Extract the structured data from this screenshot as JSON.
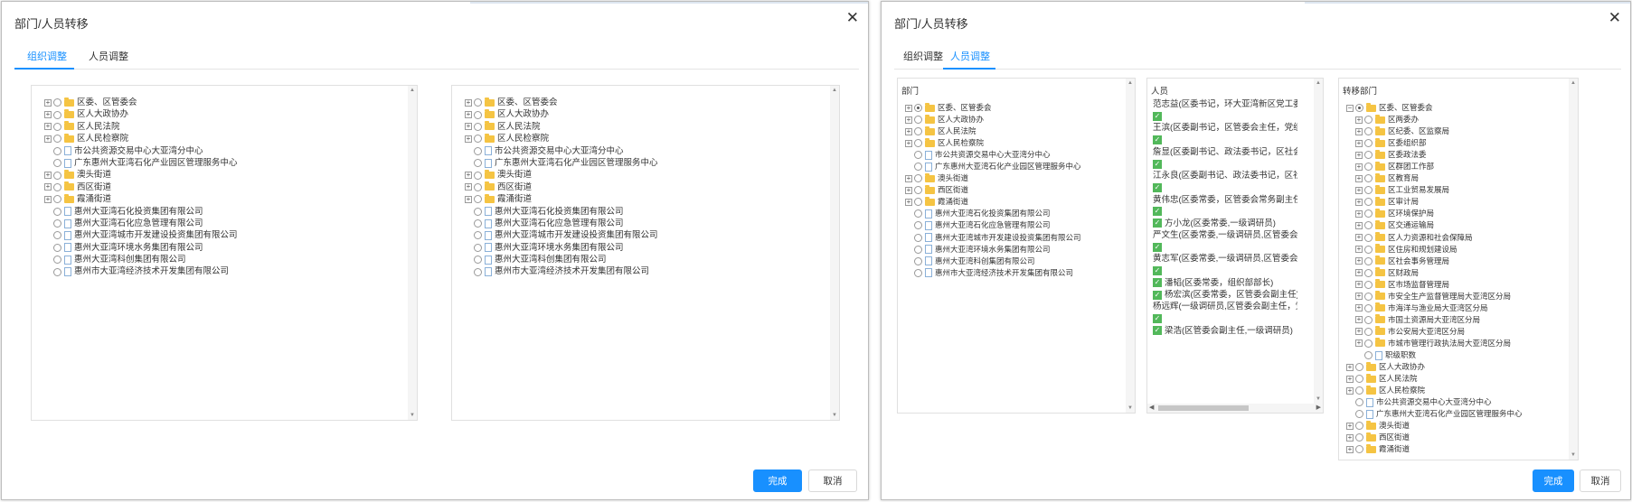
{
  "dialog1": {
    "title": "部门/人员转移",
    "tabs": {
      "org": "组织调整",
      "people": "人员调整"
    },
    "left_tree": [
      {
        "exp": "+",
        "icon": "folder",
        "label": "区委、区管委会"
      },
      {
        "exp": "+",
        "icon": "folder",
        "label": "区人大政协办"
      },
      {
        "exp": "+",
        "icon": "folder",
        "label": "区人民法院"
      },
      {
        "exp": "+",
        "icon": "folder",
        "label": "区人民检察院"
      },
      {
        "exp": "",
        "icon": "doc",
        "label": "市公共资源交易中心大亚湾分中心"
      },
      {
        "exp": "",
        "icon": "doc",
        "label": "广东惠州大亚湾石化产业园区管理服务中心"
      },
      {
        "exp": "+",
        "icon": "folder",
        "label": "澳头街道"
      },
      {
        "exp": "+",
        "icon": "folder",
        "label": "西区街道"
      },
      {
        "exp": "+",
        "icon": "folder",
        "label": "霞涌街道"
      },
      {
        "exp": "",
        "icon": "doc",
        "label": "惠州大亚湾石化投资集团有限公司"
      },
      {
        "exp": "",
        "icon": "doc",
        "label": "惠州大亚湾石化应急管理有限公司"
      },
      {
        "exp": "",
        "icon": "doc",
        "label": "惠州大亚湾城市开发建设投资集团有限公司"
      },
      {
        "exp": "",
        "icon": "doc",
        "label": "惠州大亚湾环境水务集团有限公司"
      },
      {
        "exp": "",
        "icon": "doc",
        "label": "惠州大亚湾科创集团有限公司"
      },
      {
        "exp": "",
        "icon": "doc",
        "label": "惠州市大亚湾经济技术开发集团有限公司"
      }
    ],
    "right_tree": [
      {
        "exp": "+",
        "icon": "folder",
        "label": "区委、区管委会"
      },
      {
        "exp": "+",
        "icon": "folder",
        "label": "区人大政协办"
      },
      {
        "exp": "+",
        "icon": "folder",
        "label": "区人民法院"
      },
      {
        "exp": "+",
        "icon": "folder",
        "label": "区人民检察院"
      },
      {
        "exp": "",
        "icon": "doc",
        "label": "市公共资源交易中心大亚湾分中心"
      },
      {
        "exp": "",
        "icon": "doc",
        "label": "广东惠州大亚湾石化产业园区管理服务中心"
      },
      {
        "exp": "+",
        "icon": "folder",
        "label": "澳头街道"
      },
      {
        "exp": "+",
        "icon": "folder",
        "label": "西区街道"
      },
      {
        "exp": "+",
        "icon": "folder",
        "label": "霞涌街道"
      },
      {
        "exp": "",
        "icon": "doc",
        "label": "惠州大亚湾石化投资集团有限公司"
      },
      {
        "exp": "",
        "icon": "doc",
        "label": "惠州大亚湾石化应急管理有限公司"
      },
      {
        "exp": "",
        "icon": "doc",
        "label": "惠州大亚湾城市开发建设投资集团有限公司"
      },
      {
        "exp": "",
        "icon": "doc",
        "label": "惠州大亚湾环境水务集团有限公司"
      },
      {
        "exp": "",
        "icon": "doc",
        "label": "惠州大亚湾科创集团有限公司"
      },
      {
        "exp": "",
        "icon": "doc",
        "label": "惠州市大亚湾经济技术开发集团有限公司"
      }
    ],
    "confirm": "完成",
    "cancel": "取消"
  },
  "dialog2": {
    "title": "部门/人员转移",
    "tabs": {
      "org": "组织调整",
      "people": "人员调整"
    },
    "dept_title": "部门",
    "dept_tree": [
      {
        "exp": "+",
        "icon": "folder",
        "label": "区委、区管委会",
        "sel": true
      },
      {
        "exp": "+",
        "icon": "folder",
        "label": "区人大政协办"
      },
      {
        "exp": "+",
        "icon": "folder",
        "label": "区人民法院"
      },
      {
        "exp": "+",
        "icon": "folder",
        "label": "区人民检察院"
      },
      {
        "exp": "",
        "icon": "doc",
        "label": "市公共资源交易中心大亚湾分中心"
      },
      {
        "exp": "",
        "icon": "doc",
        "label": "广东惠州大亚湾石化产业园区管理服务中心"
      },
      {
        "exp": "+",
        "icon": "folder",
        "label": "澳头街道"
      },
      {
        "exp": "+",
        "icon": "folder",
        "label": "西区街道"
      },
      {
        "exp": "+",
        "icon": "folder",
        "label": "霞涌街道"
      },
      {
        "exp": "",
        "icon": "doc",
        "label": "惠州大亚湾石化投资集团有限公司"
      },
      {
        "exp": "",
        "icon": "doc",
        "label": "惠州大亚湾石化应急管理有限公司"
      },
      {
        "exp": "",
        "icon": "doc",
        "label": "惠州大亚湾城市开发建设投资集团有限公司"
      },
      {
        "exp": "",
        "icon": "doc",
        "label": "惠州大亚湾环境水务集团有限公司"
      },
      {
        "exp": "",
        "icon": "doc",
        "label": "惠州大亚湾科创集团有限公司"
      },
      {
        "exp": "",
        "icon": "doc",
        "label": "惠州市大亚湾经济技术开发集团有限公司"
      }
    ],
    "people_title": "人员",
    "people": [
      {
        "label": "范志益(区委书记，环大亚湾新区党工委委员，管委会主任)",
        "check": "next"
      },
      {
        "label": "王滨(区委副书记，区管委会主任，党组书记)",
        "check": "next"
      },
      {
        "label": "詹显(区委副书记、政法委书记，区社会工作委员会主任)",
        "check": "next"
      },
      {
        "label": "江永良(区委副书记、政法委书记，区社会工作部部长)",
        "check": "next"
      },
      {
        "label": "黄伟忠(区委常委，区管委会常务副主任，区管委会党组副书记)",
        "check": "next"
      },
      {
        "label": "方小龙(区委常委,一级调研员)",
        "check": "inline"
      },
      {
        "label": "严文生(区委常委,一级调研员,区管委会党组成员)",
        "check": "next"
      },
      {
        "label": "黄志军(区委常委,一级调研员,区管委会党组成员)",
        "check": "next"
      },
      {
        "label": "潘韬(区委常委，组织部部长)",
        "check": "inline"
      },
      {
        "label": "杨宏滨(区委常委，区管委会副主任)",
        "check": "inline"
      },
      {
        "label": "杨远辉(一级调研员,区管委会副主任，党组成员)",
        "check": "next"
      },
      {
        "label": "梁浩(区管委会副主任,一级调研员)",
        "check": "inline"
      }
    ],
    "target_title": "转移部门",
    "target_tree": [
      {
        "lvl": 0,
        "exp": "−",
        "icon": "folder",
        "label": "区委、区管委会",
        "sel": true
      },
      {
        "lvl": 1,
        "exp": "+",
        "icon": "folder",
        "label": "区两委办"
      },
      {
        "lvl": 1,
        "exp": "+",
        "icon": "folder",
        "label": "区纪委、区监察局"
      },
      {
        "lvl": 1,
        "exp": "+",
        "icon": "folder",
        "label": "区委组织部"
      },
      {
        "lvl": 1,
        "exp": "+",
        "icon": "folder",
        "label": "区委政法委"
      },
      {
        "lvl": 1,
        "exp": "+",
        "icon": "folder",
        "label": "区群团工作部"
      },
      {
        "lvl": 1,
        "exp": "+",
        "icon": "folder",
        "label": "区教育局"
      },
      {
        "lvl": 1,
        "exp": "+",
        "icon": "folder",
        "label": "区工业贸易发展局"
      },
      {
        "lvl": 1,
        "exp": "+",
        "icon": "folder",
        "label": "区审计局"
      },
      {
        "lvl": 1,
        "exp": "+",
        "icon": "folder",
        "label": "区环境保护局"
      },
      {
        "lvl": 1,
        "exp": "+",
        "icon": "folder",
        "label": "区交通运输局"
      },
      {
        "lvl": 1,
        "exp": "+",
        "icon": "folder",
        "label": "区人力资源和社会保障局"
      },
      {
        "lvl": 1,
        "exp": "+",
        "icon": "folder",
        "label": "区住房和规划建设局"
      },
      {
        "lvl": 1,
        "exp": "+",
        "icon": "folder",
        "label": "区社会事务管理局"
      },
      {
        "lvl": 1,
        "exp": "+",
        "icon": "folder",
        "label": "区财政局"
      },
      {
        "lvl": 1,
        "exp": "+",
        "icon": "folder",
        "label": "区市场监督管理局"
      },
      {
        "lvl": 1,
        "exp": "+",
        "icon": "folder",
        "label": "市安全生产监督管理局大亚湾区分局"
      },
      {
        "lvl": 1,
        "exp": "+",
        "icon": "folder",
        "label": "市海洋与渔业局大亚湾区分局"
      },
      {
        "lvl": 1,
        "exp": "+",
        "icon": "folder",
        "label": "市国土资源局大亚湾区分局"
      },
      {
        "lvl": 1,
        "exp": "+",
        "icon": "folder",
        "label": "市公安局大亚湾区分局"
      },
      {
        "lvl": 1,
        "exp": "+",
        "icon": "folder",
        "label": "市城市管理行政执法局大亚湾区分局"
      },
      {
        "lvl": 1,
        "exp": "",
        "icon": "doc",
        "label": "职级职数"
      },
      {
        "lvl": 0,
        "exp": "+",
        "icon": "folder",
        "label": "区人大政协办"
      },
      {
        "lvl": 0,
        "exp": "+",
        "icon": "folder",
        "label": "区人民法院"
      },
      {
        "lvl": 0,
        "exp": "+",
        "icon": "folder",
        "label": "区人民检察院"
      },
      {
        "lvl": 0,
        "exp": "",
        "icon": "doc",
        "label": "市公共资源交易中心大亚湾分中心"
      },
      {
        "lvl": 0,
        "exp": "",
        "icon": "doc",
        "label": "广东惠州大亚湾石化产业园区管理服务中心"
      },
      {
        "lvl": 0,
        "exp": "+",
        "icon": "folder",
        "label": "澳头街道"
      },
      {
        "lvl": 0,
        "exp": "+",
        "icon": "folder",
        "label": "西区街道"
      },
      {
        "lvl": 0,
        "exp": "+",
        "icon": "folder",
        "label": "霞涌街道"
      }
    ],
    "confirm": "完成",
    "cancel": "取消"
  }
}
